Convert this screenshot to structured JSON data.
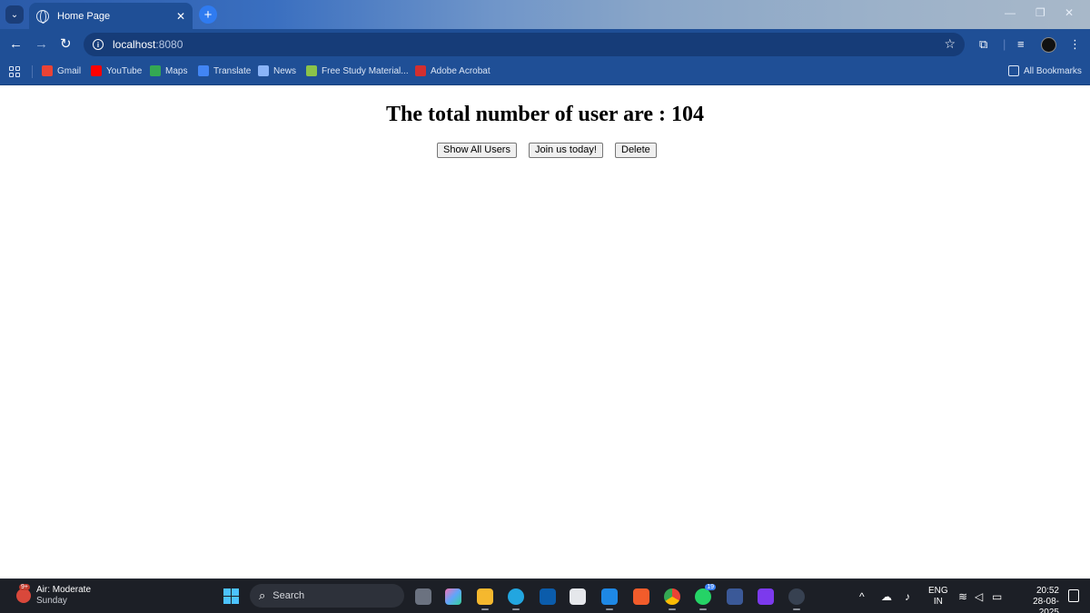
{
  "browser": {
    "tab_title": "Home Page",
    "tab_close": "✕",
    "new_tab": "+",
    "url_host": "localhost",
    "url_port": ":8080",
    "icons": [
      "tab-search-icon",
      "globe-icon",
      "back-icon",
      "forward-icon",
      "reload-icon",
      "info-icon",
      "star-icon",
      "extensions-icon",
      "media-icon",
      "menu-icon"
    ]
  },
  "bookmarks": [
    {
      "label": "Gmail",
      "color": "#ea4335"
    },
    {
      "label": "YouTube",
      "color": "#ff0000"
    },
    {
      "label": "Maps",
      "color": "#34a853"
    },
    {
      "label": "Translate",
      "color": "#4285f4"
    },
    {
      "label": "News",
      "color": "#8ab4f8"
    },
    {
      "label": "Free Study Material...",
      "color": "#8bc34a"
    },
    {
      "label": "Adobe Acrobat",
      "color": "#d32f2f"
    }
  ],
  "all_bookmarks": "All Bookmarks",
  "page": {
    "heading": "The total number of user are : 104",
    "buttons": {
      "show_all": "Show All Users",
      "join": "Join us today!",
      "delete": "Delete"
    }
  },
  "taskbar": {
    "weather_badge": "9+",
    "weather_line1": "Air: Moderate",
    "weather_line2": "Sunday",
    "search_label": "Search",
    "whatsapp_badge": "19",
    "lang_line1": "ENG",
    "lang_line2": "IN",
    "time": "20:52",
    "date": "28-08-2025"
  }
}
